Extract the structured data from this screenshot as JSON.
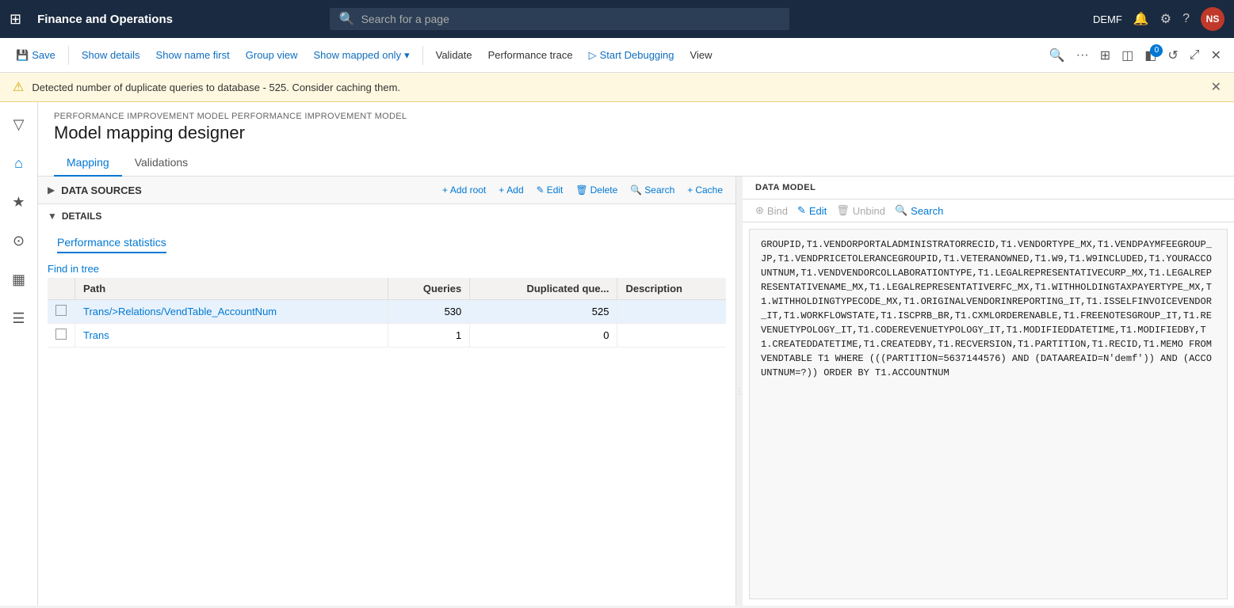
{
  "topnav": {
    "grid_icon": "⊞",
    "title": "Finance and Operations",
    "search_placeholder": "Search for a page",
    "right": {
      "env": "DEMF",
      "bell_icon": "🔔",
      "gear_icon": "⚙",
      "help_icon": "?",
      "avatar": "NS"
    }
  },
  "toolbar": {
    "save_label": "Save",
    "show_details_label": "Show details",
    "show_name_label": "Show name first",
    "group_view_label": "Group view",
    "show_mapped_label": "Show mapped only",
    "validate_label": "Validate",
    "perf_trace_label": "Performance trace",
    "start_debug_label": "Start Debugging",
    "view_label": "View",
    "badge_count": "0"
  },
  "warning": {
    "text": "Detected number of duplicate queries to database - 525. Consider caching them."
  },
  "sidebar": {
    "icons": [
      "⌂",
      "★",
      "⊙",
      "▦",
      "☰"
    ]
  },
  "page": {
    "breadcrumb": "PERFORMANCE IMPROVEMENT MODEL PERFORMANCE IMPROVEMENT MODEL",
    "title": "Model mapping designer",
    "tabs": [
      {
        "label": "Mapping",
        "active": true
      },
      {
        "label": "Validations",
        "active": false
      }
    ]
  },
  "data_sources": {
    "label": "DATA SOURCES",
    "actions": [
      {
        "icon": "+",
        "label": "Add root"
      },
      {
        "icon": "+",
        "label": "Add"
      },
      {
        "icon": "✎",
        "label": "Edit"
      },
      {
        "icon": "🗑",
        "label": "Delete"
      },
      {
        "icon": "🔍",
        "label": "Search"
      },
      {
        "icon": "+",
        "label": "Cache"
      }
    ]
  },
  "details": {
    "label": "DETAILS",
    "tab_label": "Performance statistics",
    "find_link": "Find in tree"
  },
  "table": {
    "columns": [
      {
        "key": "check",
        "label": ""
      },
      {
        "key": "path",
        "label": "Path"
      },
      {
        "key": "queries",
        "label": "Queries"
      },
      {
        "key": "dup_queries",
        "label": "Duplicated que..."
      },
      {
        "key": "description",
        "label": "Description"
      }
    ],
    "rows": [
      {
        "check": "",
        "path": "Trans/>Relations/VendTable_AccountNum",
        "queries": "530",
        "dup_queries": "525",
        "description": "",
        "selected": true
      },
      {
        "check": "",
        "path": "Trans",
        "queries": "1",
        "dup_queries": "0",
        "description": "",
        "selected": false
      }
    ]
  },
  "data_model": {
    "header": "DATA MODEL",
    "actions": [
      {
        "icon": "⊛",
        "label": "Bind",
        "disabled": true
      },
      {
        "icon": "✎",
        "label": "Edit",
        "disabled": false
      },
      {
        "icon": "🗑",
        "label": "Unbind",
        "disabled": true
      },
      {
        "icon": "🔍",
        "label": "Search",
        "disabled": false
      }
    ]
  },
  "sql": {
    "content": "GROUPID,T1.VENDORPORTALADMINISTRATORRECID,T1.VENDORTYPE_MX,T1.VENDPAYMFEEGROUP_JP,T1.VENDPRICETOLERANCEGROUPID,T1.VETERANOWNED,T1.W9,T1.W9INCLUDED,T1.YOURACCOUNTNUM,T1.VENDVENDORCOLLABORATIONTYPE,T1.LEGALREPRESENTATIVECURP_MX,T1.LEGALREPRESENTATIVENAME_MX,T1.LEGALREPRESENTATIVERFC_MX,T1.WITHHOLDINGTAXPAYERTYPE_MX,T1.WITHHOLDINGTYPECODE_MX,T1.ORIGINALVENDORINREPORTING_IT,T1.ISSELFINVOICEVENDOR_IT,T1.WORKFLOWSTATE,T1.ISCPRB_BR,T1.CXMLORDERENABLE,T1.FREENOTESGROUP_IT,T1.REVENUETYPOLOGY_IT,T1.CODEREVENUETYPOLOGY_IT,T1.MODIFIEDDATETIME,T1.MODIFIEDBY,T1.CREATEDDATETIME,T1.CREATEDBY,T1.RECVERSION,T1.PARTITION,T1.RECID,T1.MEMO FROM VENDTABLE T1 WHERE (((PARTITION=5637144576) AND (DATAAREAID=N'demf')) AND (ACCOUNTNUM=?)) ORDER BY T1.ACCOUNTNUM"
  }
}
